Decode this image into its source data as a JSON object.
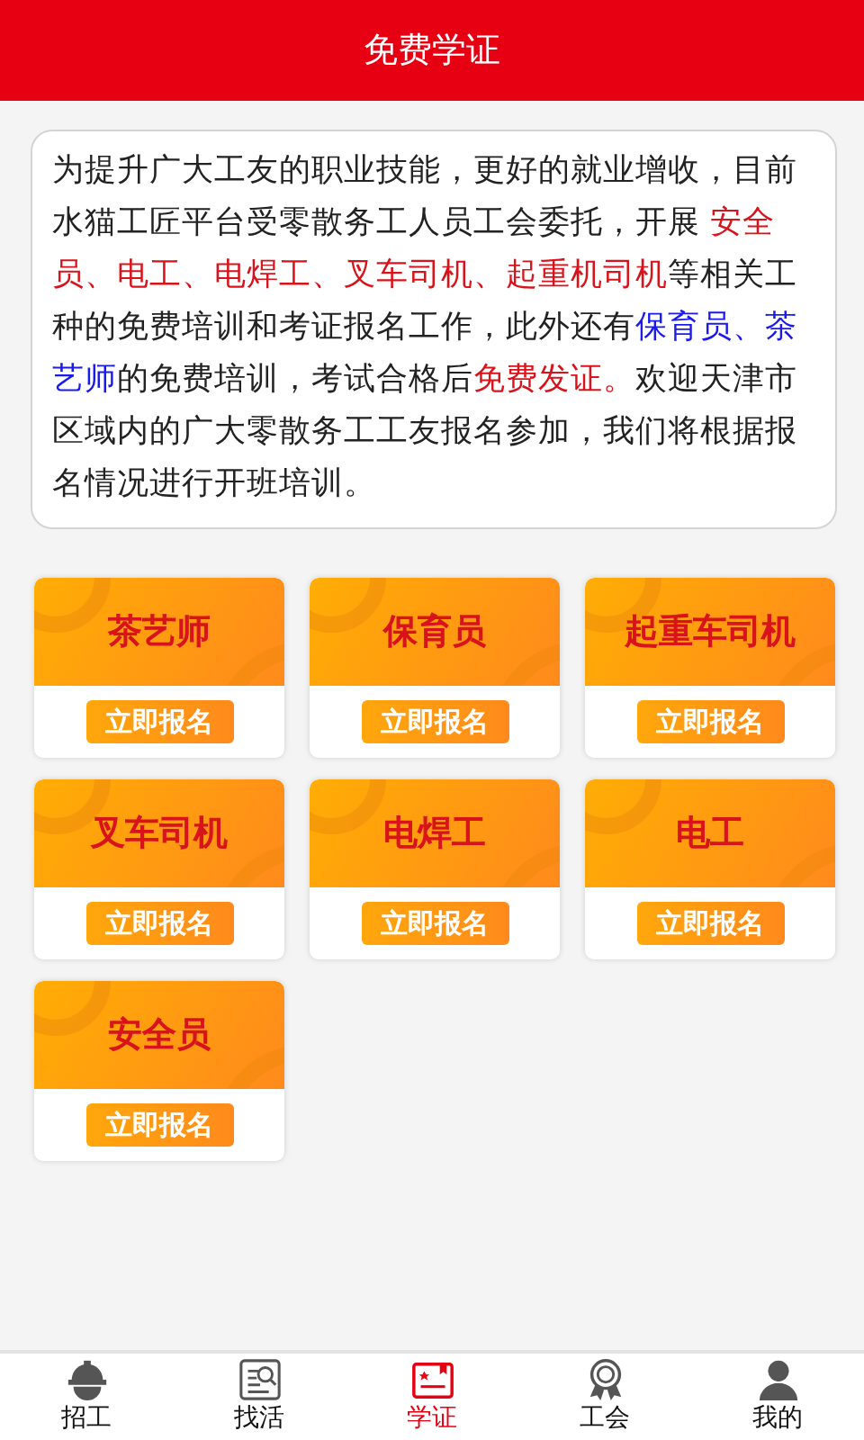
{
  "header": {
    "title": "免费学证"
  },
  "intro": [
    {
      "kind": "plain",
      "text": "为提升广大工友的职业技能，更好的就业增收，目前水猫工匠平台受零散务工人员工会委托，开展 "
    },
    {
      "kind": "red",
      "text": "安全员、电工、电焊工、叉车司机、起重机司机"
    },
    {
      "kind": "plain",
      "text": "等相关工种的免费培训和考证报名工作，此外还有"
    },
    {
      "kind": "blue",
      "text": "保育员、茶艺师"
    },
    {
      "kind": "plain",
      "text": "的免费培训，考试合格后"
    },
    {
      "kind": "red",
      "text": "免费发证。"
    },
    {
      "kind": "plain",
      "text": "欢迎天津市区域内的广大零散务工工友报名参加，我们将根据报名情况进行开班培训。"
    }
  ],
  "courses": [
    {
      "title": "茶艺师",
      "button": "立即报名"
    },
    {
      "title": "保育员",
      "button": "立即报名"
    },
    {
      "title": "起重车司机",
      "button": "立即报名"
    },
    {
      "title": "叉车司机",
      "button": "立即报名"
    },
    {
      "title": "电焊工",
      "button": "立即报名"
    },
    {
      "title": "电工",
      "button": "立即报名"
    },
    {
      "title": "安全员",
      "button": "立即报名"
    }
  ],
  "tabs": [
    {
      "label": "招工",
      "selected": false
    },
    {
      "label": "找活",
      "selected": false
    },
    {
      "label": "学证",
      "selected": true
    },
    {
      "label": "工会",
      "selected": false
    },
    {
      "label": "我的",
      "selected": false
    }
  ]
}
